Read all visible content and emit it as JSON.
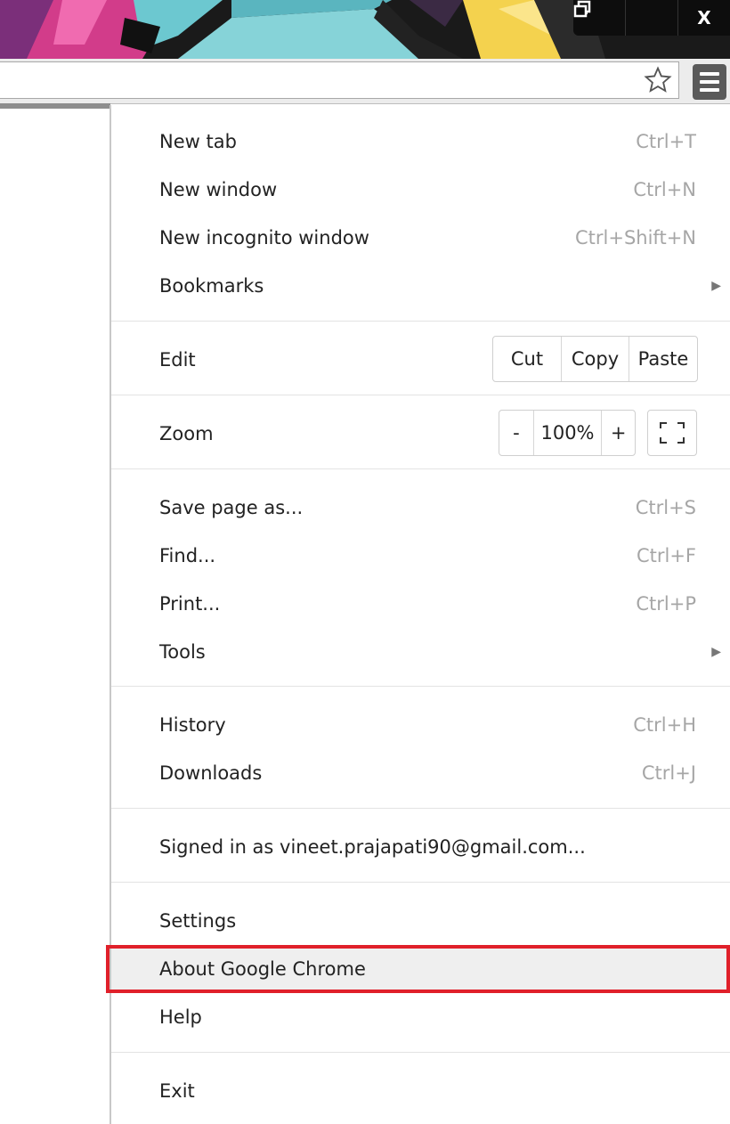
{
  "window": {
    "controls": {
      "minimize": "—",
      "maximize": "⧉",
      "close": "X"
    }
  },
  "toolbar": {
    "star_icon": "bookmark-star-icon",
    "menu_icon": "hamburger-menu-icon"
  },
  "menu": {
    "new_tab": {
      "label": "New tab",
      "shortcut": "Ctrl+T"
    },
    "new_window": {
      "label": "New window",
      "shortcut": "Ctrl+N"
    },
    "new_incognito": {
      "label": "New incognito window",
      "shortcut": "Ctrl+Shift+N"
    },
    "bookmarks": {
      "label": "Bookmarks",
      "arrow": "▶"
    },
    "edit": {
      "label": "Edit",
      "cut": "Cut",
      "copy": "Copy",
      "paste": "Paste"
    },
    "zoom": {
      "label": "Zoom",
      "minus": "-",
      "value": "100%",
      "plus": "+"
    },
    "save_page": {
      "label": "Save page as...",
      "shortcut": "Ctrl+S"
    },
    "find": {
      "label": "Find...",
      "shortcut": "Ctrl+F"
    },
    "print": {
      "label": "Print...",
      "shortcut": "Ctrl+P"
    },
    "tools": {
      "label": "Tools",
      "arrow": "▶"
    },
    "history": {
      "label": "History",
      "shortcut": "Ctrl+H"
    },
    "downloads": {
      "label": "Downloads",
      "shortcut": "Ctrl+J"
    },
    "signed_in": {
      "label": "Signed in as vineet.prajapati90@gmail.com..."
    },
    "settings": {
      "label": "Settings"
    },
    "about": {
      "label": "About Google Chrome"
    },
    "help": {
      "label": "Help"
    },
    "exit": {
      "label": "Exit"
    }
  },
  "colors": {
    "highlight_border": "#e0202a",
    "shortcut_text": "#a6a6a6"
  }
}
